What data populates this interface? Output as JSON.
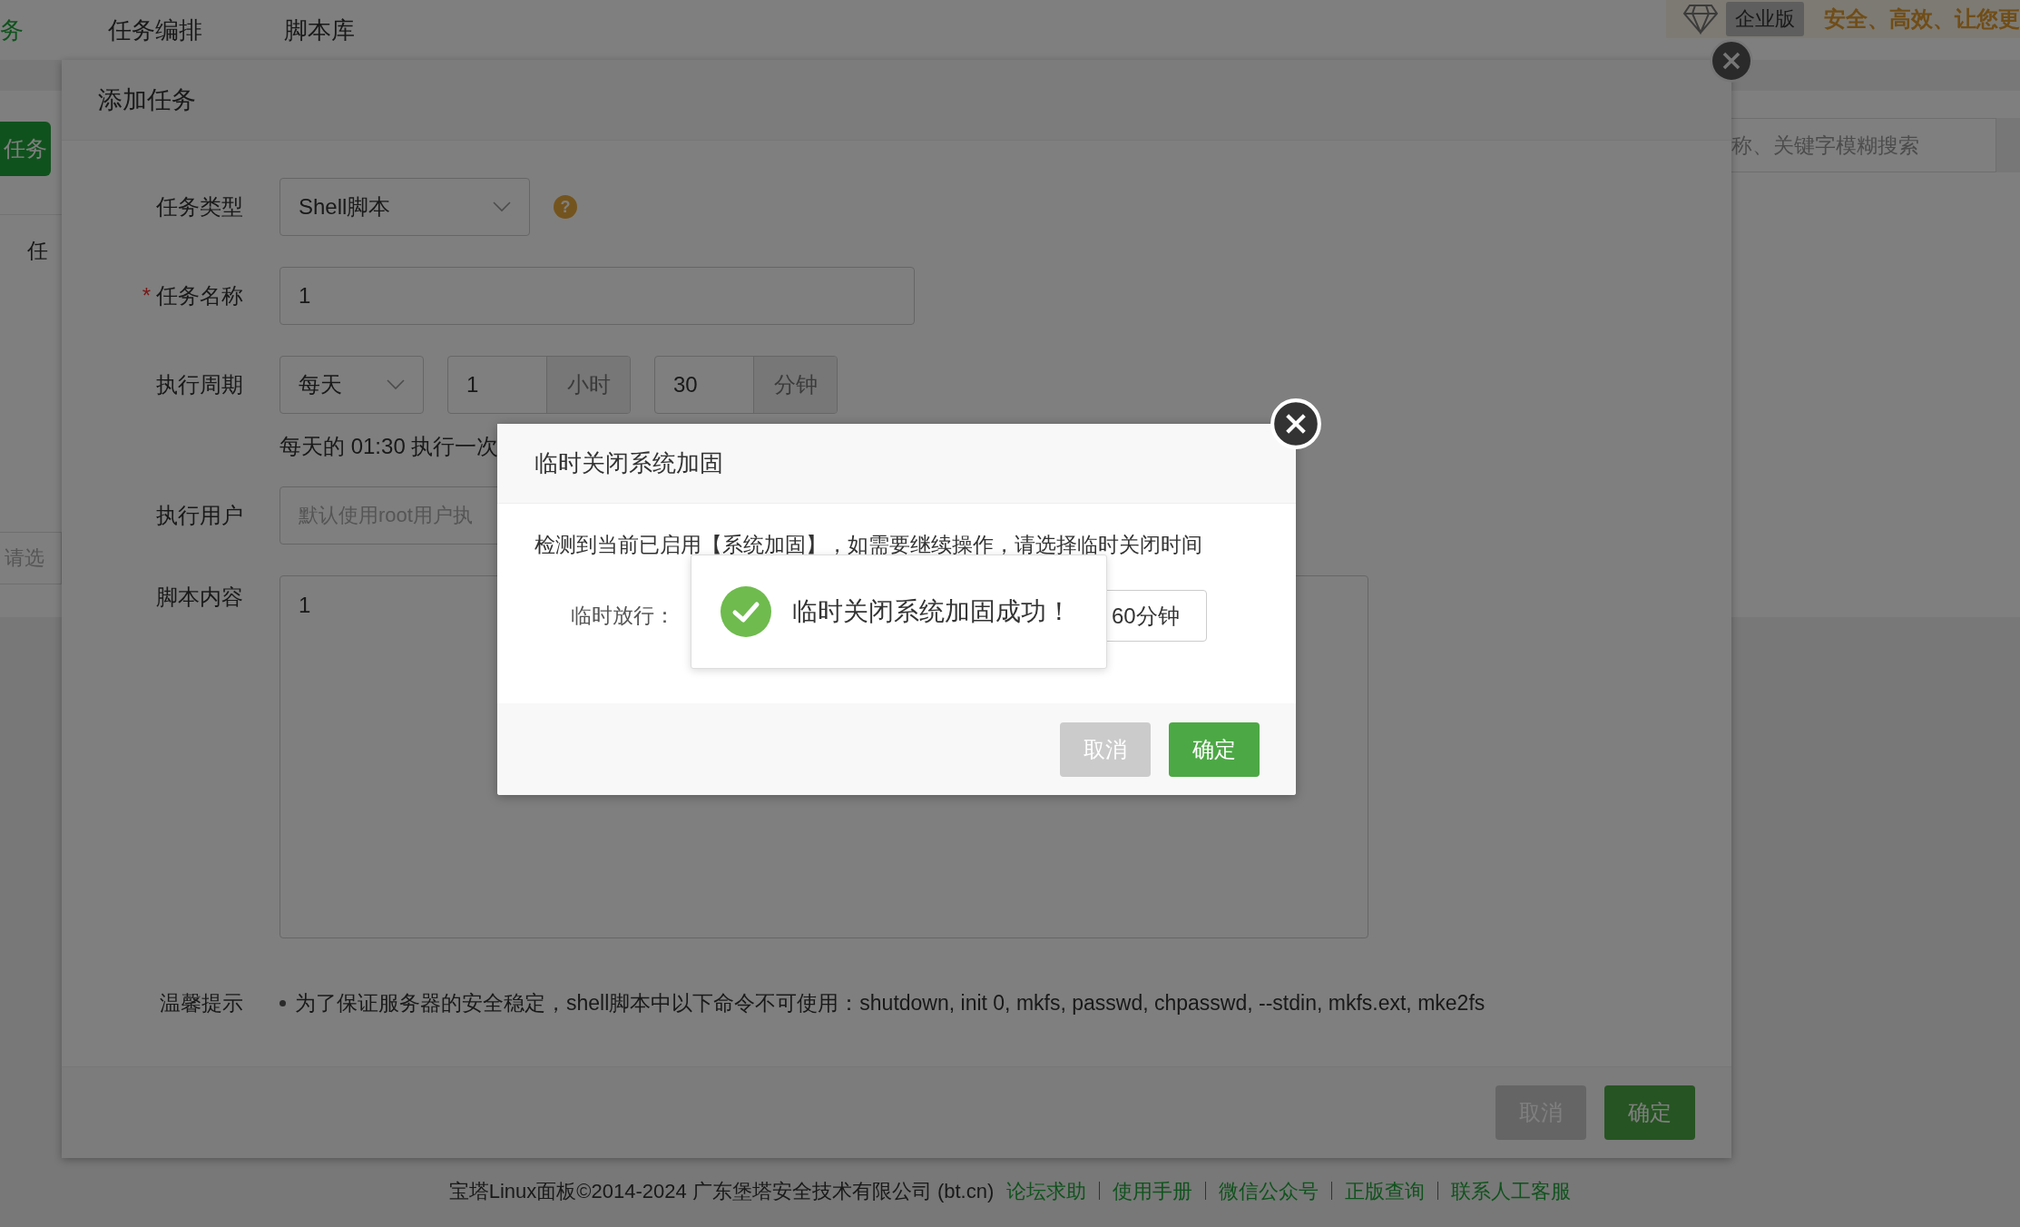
{
  "top_nav": {
    "items": [
      {
        "label": "务",
        "selected": true
      },
      {
        "label": "任务编排",
        "selected": false
      },
      {
        "label": "脚本库",
        "selected": false
      }
    ],
    "edition_badge": "企业版",
    "slogan": "安全、高效、让您更"
  },
  "background": {
    "add_button": "任务",
    "tab": "任",
    "select_placeholder": "请选",
    "search_placeholder": "称、关键字模糊搜索"
  },
  "add_task_modal": {
    "title": "添加任务",
    "task_type": {
      "label": "任务类型",
      "value": "Shell脚本",
      "help": "?"
    },
    "task_name": {
      "label": "任务名称",
      "required_mark": "*",
      "value": "1"
    },
    "schedule": {
      "label": "执行周期",
      "period": "每天",
      "hour": "1",
      "hour_unit": "小时",
      "minute": "30",
      "minute_unit": "分钟",
      "hint": "每天的 01:30 执行一次"
    },
    "user": {
      "label": "执行用户",
      "placeholder": "默认使用root用户执"
    },
    "script": {
      "label": "脚本内容",
      "value": "1"
    },
    "tips": {
      "label": "温馨提示",
      "items": [
        "为了保证服务器的安全稳定，shell脚本中以下命令不可使用：shutdown, init 0, mkfs, passwd, chpasswd, --stdin, mkfs.ext, mke2fs"
      ]
    },
    "buttons": [
      {
        "label": "取消",
        "kind": "cancel"
      },
      {
        "label": "确定",
        "kind": "primary"
      }
    ]
  },
  "confirm_dialog": {
    "title": "临时关闭系统加固",
    "message": "检测到当前已启用【系统加固】，如需要继续操作，请选择临时关闭时间",
    "field_label": "临时放行：",
    "field_value": "60分钟",
    "buttons": [
      {
        "label": "取消",
        "kind": "cancel"
      },
      {
        "label": "确定",
        "kind": "primary"
      }
    ]
  },
  "toast": {
    "message": "临时关闭系统加固成功！"
  },
  "footer": {
    "copyright": "宝塔Linux面板©2014-2024 广东堡塔安全技术有限公司 (bt.cn)",
    "links": [
      "论坛求助",
      "使用手册",
      "微信公众号",
      "正版查询",
      "联系人工客服"
    ]
  }
}
